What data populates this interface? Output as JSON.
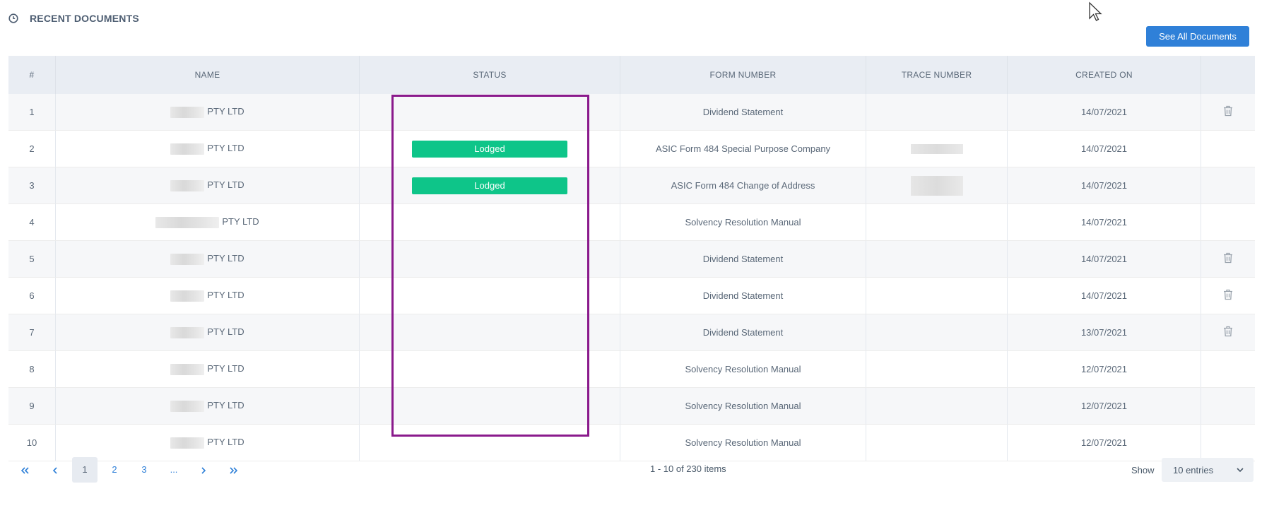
{
  "header": {
    "title": "RECENT DOCUMENTS",
    "icon": "clock-icon"
  },
  "see_all_label": "See All Documents",
  "table": {
    "columns": [
      "#",
      "NAME",
      "STATUS",
      "FORM NUMBER",
      "TRACE NUMBER",
      "CREATED ON"
    ],
    "rows": [
      {
        "num": "1",
        "name": "PTY LTD",
        "status": "",
        "form": "Dividend Statement",
        "created": "14/07/2021",
        "delete": true
      },
      {
        "num": "2",
        "name": "PTY LTD",
        "status": "Lodged",
        "form": "ASIC Form 484 Special Purpose Company",
        "created": "14/07/2021",
        "delete": false
      },
      {
        "num": "3",
        "name": "PTY LTD",
        "status": "Lodged",
        "form": "ASIC Form 484 Change of Address",
        "created": "14/07/2021",
        "delete": false
      },
      {
        "num": "4",
        "name": "PTY LTD",
        "status": "",
        "form": "Solvency Resolution Manual",
        "created": "14/07/2021",
        "delete": false
      },
      {
        "num": "5",
        "name": "PTY LTD",
        "status": "",
        "form": "Dividend Statement",
        "created": "14/07/2021",
        "delete": true
      },
      {
        "num": "6",
        "name": "PTY LTD",
        "status": "",
        "form": "Dividend Statement",
        "created": "14/07/2021",
        "delete": true
      },
      {
        "num": "7",
        "name": "PTY LTD",
        "status": "",
        "form": "Dividend Statement",
        "created": "13/07/2021",
        "delete": true
      },
      {
        "num": "8",
        "name": "PTY LTD",
        "status": "",
        "form": "Solvency Resolution Manual",
        "created": "12/07/2021",
        "delete": false
      },
      {
        "num": "9",
        "name": "PTY LTD",
        "status": "",
        "form": "Solvency Resolution Manual",
        "created": "12/07/2021",
        "delete": false
      },
      {
        "num": "10",
        "name": "PTY LTD",
        "status": "",
        "form": "Solvency Resolution Manual",
        "created": "12/07/2021",
        "delete": false
      }
    ]
  },
  "pagination": {
    "pages": [
      "1",
      "2",
      "3"
    ],
    "ellipsis": "...",
    "current": "1",
    "summary": "1 - 10 of 230 items",
    "show_label": "Show",
    "entries_value": "10 entries"
  },
  "colors": {
    "accent": "#2f80d8",
    "lodged": "#0ec589",
    "highlight": "#8a1a8c"
  }
}
